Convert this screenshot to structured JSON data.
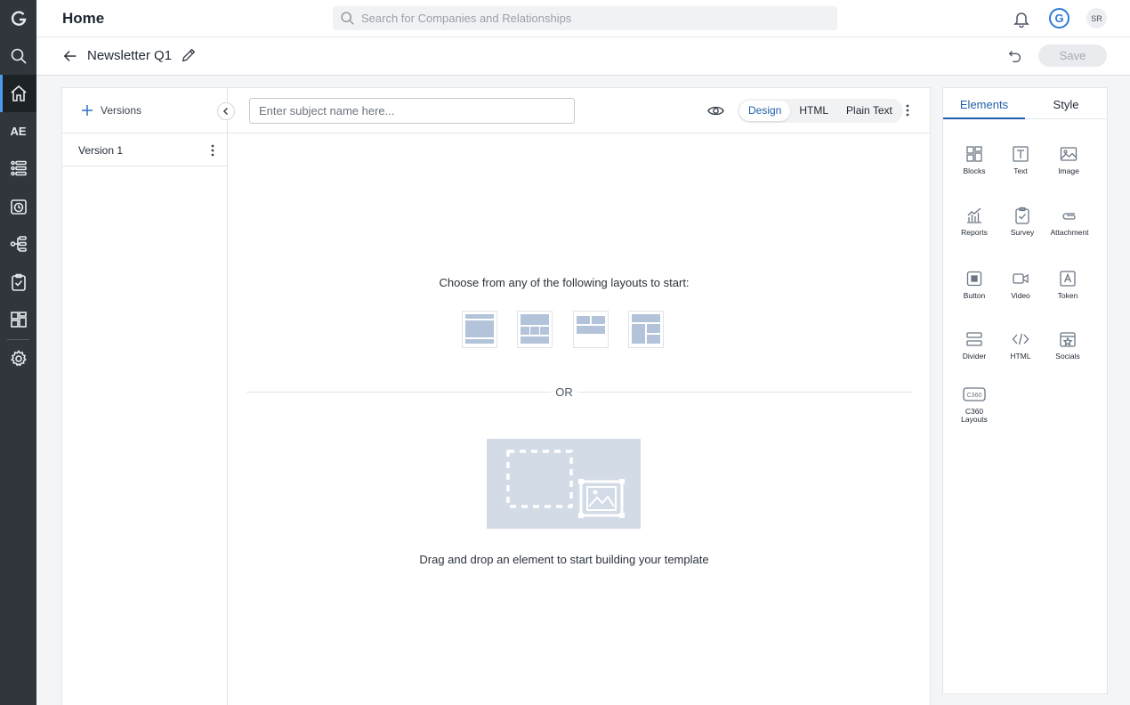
{
  "header": {
    "title": "Home",
    "search_placeholder": "Search for Companies and Relationships",
    "avatar_initials": "SR",
    "brand_letter": "G"
  },
  "rail": {
    "ae_label": "AE"
  },
  "subheader": {
    "title": "Newsletter Q1",
    "save_label": "Save"
  },
  "versions": {
    "add_label": "Versions",
    "items": [
      {
        "label": "Version 1"
      }
    ]
  },
  "editor": {
    "subject_placeholder": "Enter subject name here...",
    "modes": [
      {
        "label": "Design",
        "active": true
      },
      {
        "label": "HTML",
        "active": false
      },
      {
        "label": "Plain Text",
        "active": false
      }
    ],
    "choose_text": "Choose from any of the following layouts to start:",
    "or_text": "OR",
    "drag_text": "Drag and drop an element to start building your template"
  },
  "panel": {
    "tabs": [
      {
        "label": "Elements",
        "active": true
      },
      {
        "label": "Style",
        "active": false
      }
    ],
    "elements": [
      {
        "label": "Blocks",
        "icon": "blocks-icon"
      },
      {
        "label": "Text",
        "icon": "text-icon"
      },
      {
        "label": "Image",
        "icon": "image-icon"
      },
      {
        "label": "Reports",
        "icon": "reports-icon"
      },
      {
        "label": "Survey",
        "icon": "survey-icon"
      },
      {
        "label": "Attachment",
        "icon": "attachment-icon"
      },
      {
        "label": "Button",
        "icon": "button-icon"
      },
      {
        "label": "Video",
        "icon": "video-icon"
      },
      {
        "label": "Token",
        "icon": "token-icon"
      },
      {
        "label": "Divider",
        "icon": "divider-icon"
      },
      {
        "label": "HTML",
        "icon": "html-icon"
      },
      {
        "label": "Socials",
        "icon": "socials-icon"
      },
      {
        "label": "C360 Layouts",
        "icon": "c360-layouts-icon",
        "icon_text": "C360"
      }
    ]
  },
  "colors": {
    "rail_bg": "#31363d",
    "accent": "#1f5faa",
    "placeholder_fill": "#d3dbe7",
    "layout_block": "#b3c3d9"
  }
}
